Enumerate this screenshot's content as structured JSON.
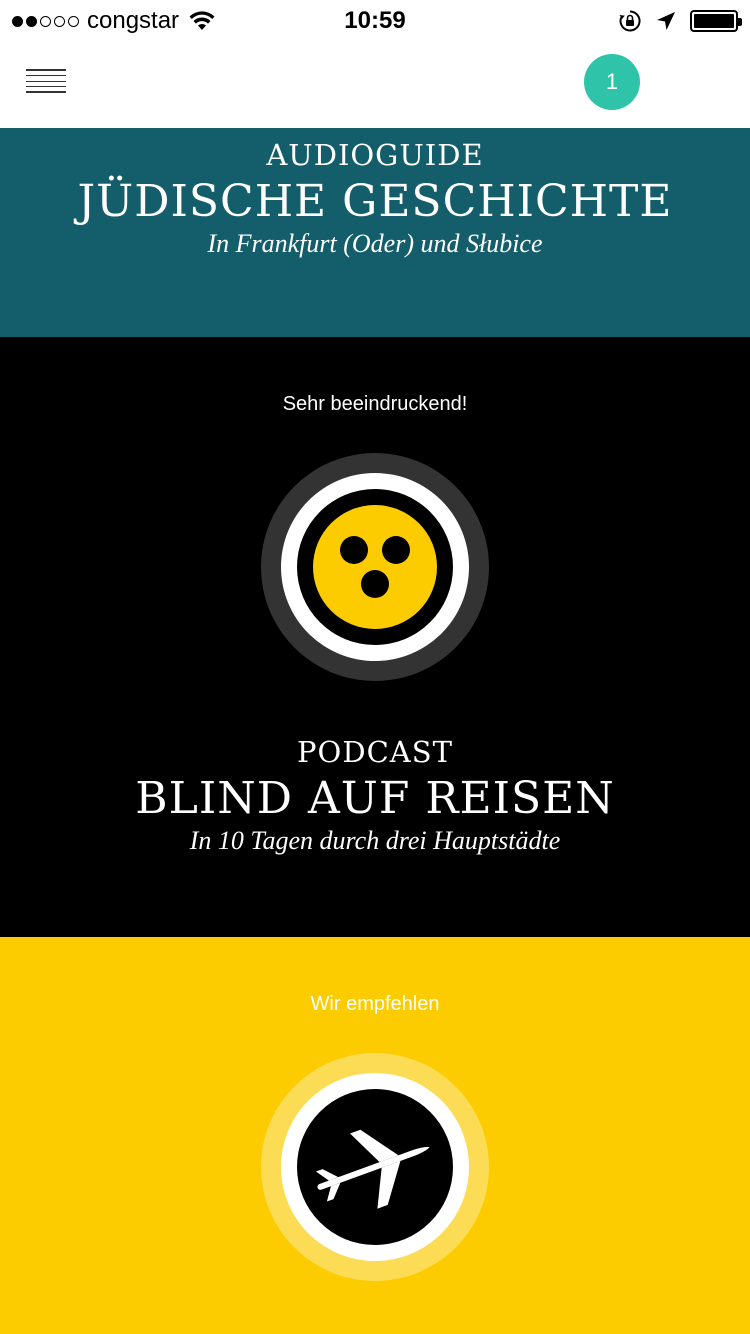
{
  "status_bar": {
    "carrier": "congstar",
    "time": "10:59",
    "signal_bars_filled": 2,
    "signal_bars_total": 5,
    "icons": [
      "wifi-icon",
      "rotation-lock-icon",
      "location-arrow-icon",
      "battery-icon"
    ]
  },
  "navbar": {
    "menu_icon": "hamburger-menu-icon",
    "badge_count": "1",
    "badge_color": "#2fc4aa"
  },
  "audioguide": {
    "kicker": "AUDIOGUIDE",
    "title": "JÜDISCHE GESCHICHTE",
    "subtitle": "In Frankfurt (Oder) und Słubice",
    "background": "#145e6b"
  },
  "podcast": {
    "note": "Sehr beeindruckend!",
    "icon": "blind-symbol-icon",
    "kicker": "PODCAST",
    "title": "BLIND AUF REISEN",
    "subtitle": "In 10 Tagen durch drei Hauptstädte",
    "background": "#000000",
    "accent": "#fccc00"
  },
  "recommendation": {
    "note": "Wir empfehlen",
    "icon": "airplane-icon",
    "background": "#fccc00"
  }
}
